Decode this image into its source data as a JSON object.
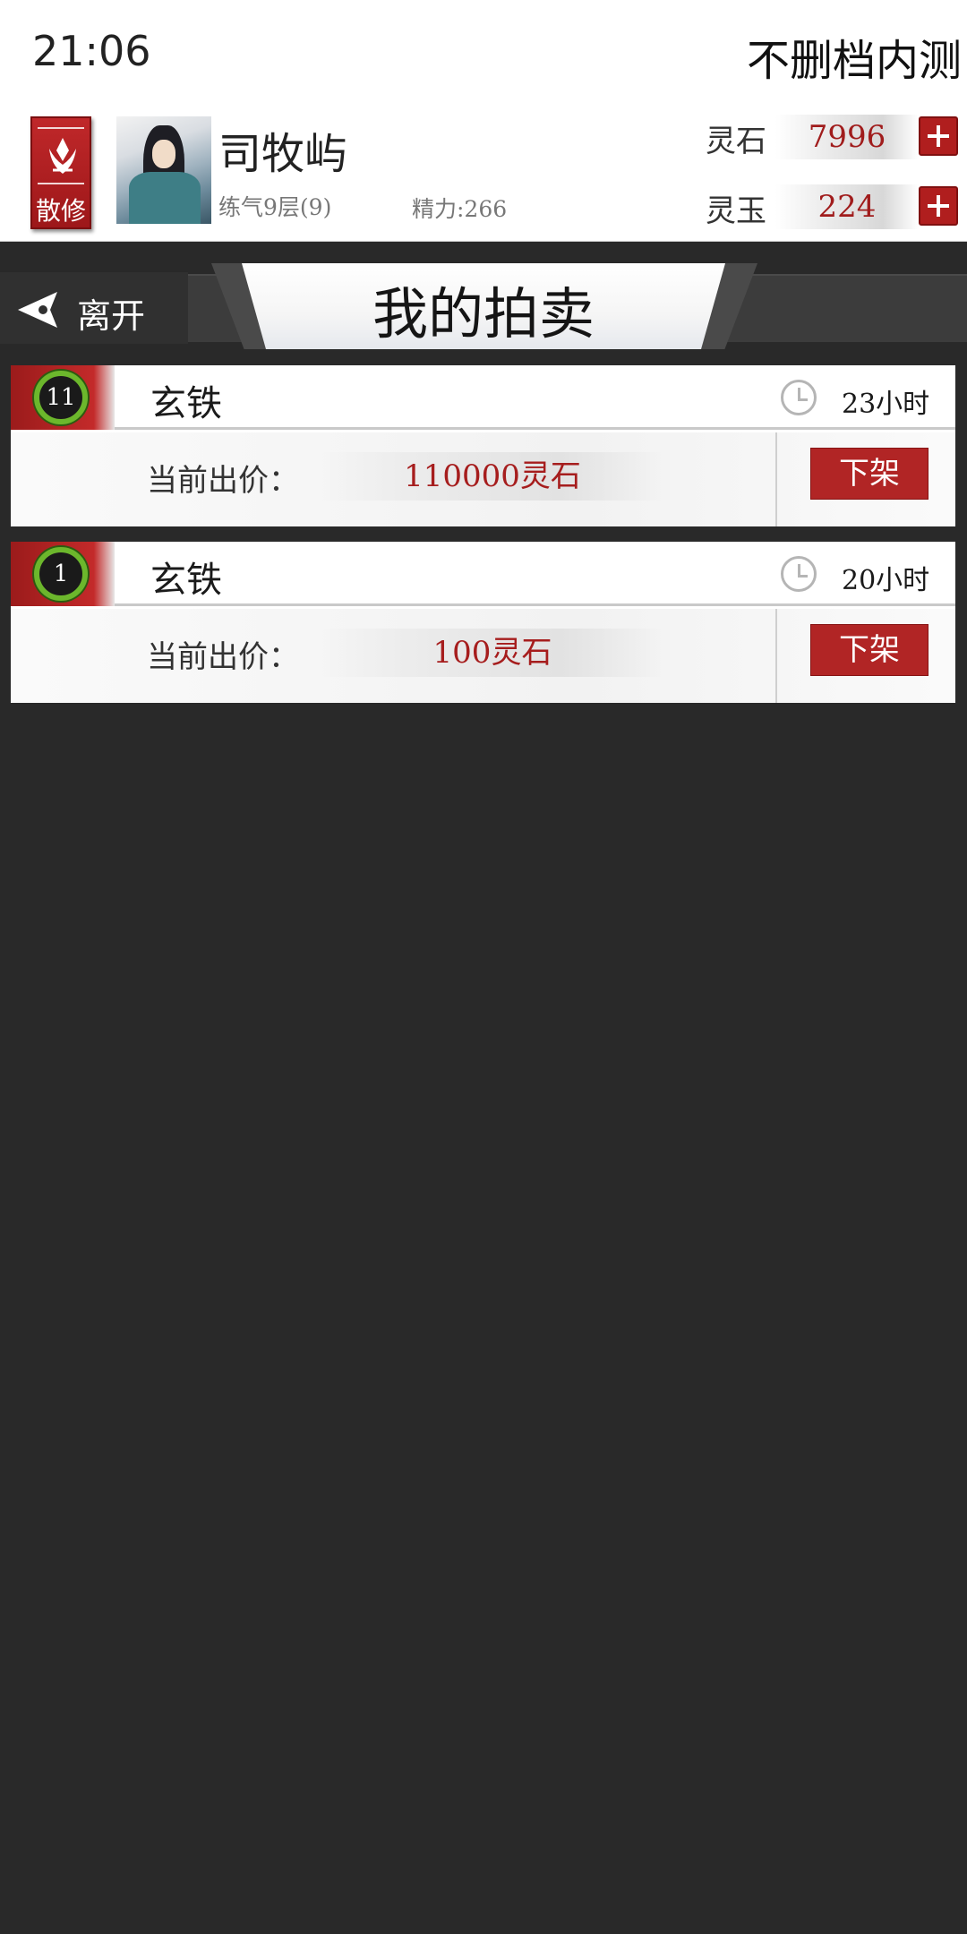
{
  "status_bar": {
    "time": "21:06",
    "right_text": "不删档内测"
  },
  "player": {
    "badge_label": "散修",
    "name": "司牧屿",
    "level": "练气9层(9)",
    "stamina": "精力:266"
  },
  "currencies": [
    {
      "label": "灵石",
      "value": "7996"
    },
    {
      "label": "灵玉",
      "value": "224"
    }
  ],
  "nav": {
    "leave_label": "离开",
    "page_title": "我的拍卖"
  },
  "auctions": [
    {
      "quantity": "11",
      "item_name": "玄铁",
      "time_left": "23小时",
      "bid_label": "当前出价：",
      "bid_value": "110000灵石",
      "action_label": "下架"
    },
    {
      "quantity": "1",
      "item_name": "玄铁",
      "time_left": "20小时",
      "bid_label": "当前出价：",
      "bid_value": "100灵石",
      "action_label": "下架"
    }
  ],
  "colors": {
    "accent_red": "#b12525",
    "background": "#292929",
    "quantity_ring": "#6cb72c"
  },
  "icons": [
    "lotus-emblem-icon",
    "plus-icon",
    "back-arrow-icon",
    "clock-icon"
  ]
}
